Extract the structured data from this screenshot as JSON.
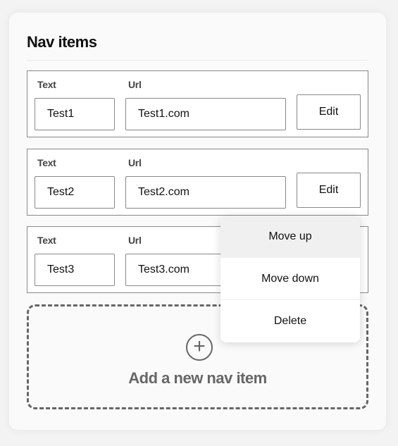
{
  "title": "Nav items",
  "labels": {
    "text": "Text",
    "url": "Url"
  },
  "edit_label": "Edit",
  "items": [
    {
      "text": "Test1",
      "url": "Test1.com"
    },
    {
      "text": "Test2",
      "url": "Test2.com"
    },
    {
      "text": "Test3",
      "url": "Test3.com"
    }
  ],
  "add": {
    "label": "Add a new nav item",
    "icon": "plus-circle-icon"
  },
  "menu": {
    "items": [
      "Move up",
      "Move down",
      "Delete"
    ],
    "highlighted": "Move up"
  }
}
